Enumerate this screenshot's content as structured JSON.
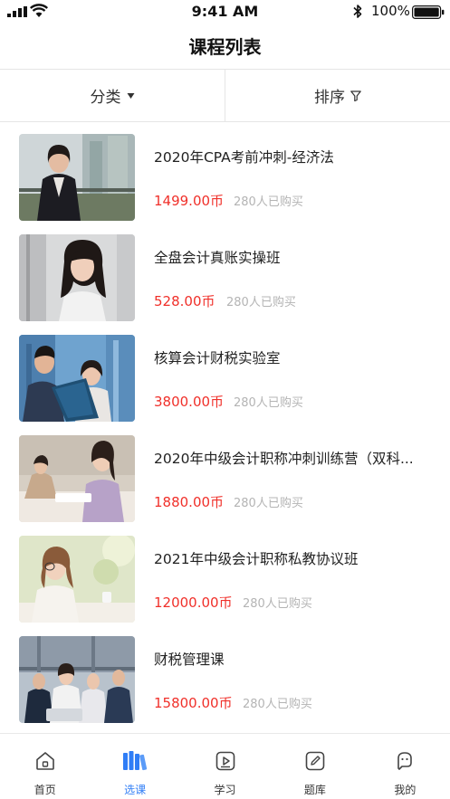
{
  "status_bar": {
    "time": "9:41 AM",
    "battery": "100%"
  },
  "header": {
    "title": "课程列表"
  },
  "filters": [
    {
      "label": "分类",
      "icon": "caret-down-icon"
    },
    {
      "label": "排序",
      "icon": "filter-icon"
    }
  ],
  "courses": [
    {
      "title": "2020年CPA考前冲刺-经济法",
      "price": "1499.00币",
      "buyers": "280人已购买"
    },
    {
      "title": "全盘会计真账实操班",
      "price": "528.00币",
      "buyers": "280人已购买"
    },
    {
      "title": "核算会计财税实验室",
      "price": "3800.00币",
      "buyers": "280人已购买"
    },
    {
      "title": "2020年中级会计职称冲刺训练营（双科...",
      "price": "1880.00币",
      "buyers": "280人已购买"
    },
    {
      "title": "2021年中级会计职称私教协议班",
      "price": "12000.00币",
      "buyers": "280人已购买"
    },
    {
      "title": "财税管理课",
      "price": "15800.00币",
      "buyers": "280人已购买"
    }
  ],
  "tabbar": {
    "active_color": "#2f7df6",
    "items": [
      {
        "label": "首页",
        "icon": "home-icon"
      },
      {
        "label": "选课",
        "icon": "books-icon",
        "active": true
      },
      {
        "label": "学习",
        "icon": "play-icon"
      },
      {
        "label": "题库",
        "icon": "edit-icon"
      },
      {
        "label": "我的",
        "icon": "profile-icon"
      }
    ]
  }
}
